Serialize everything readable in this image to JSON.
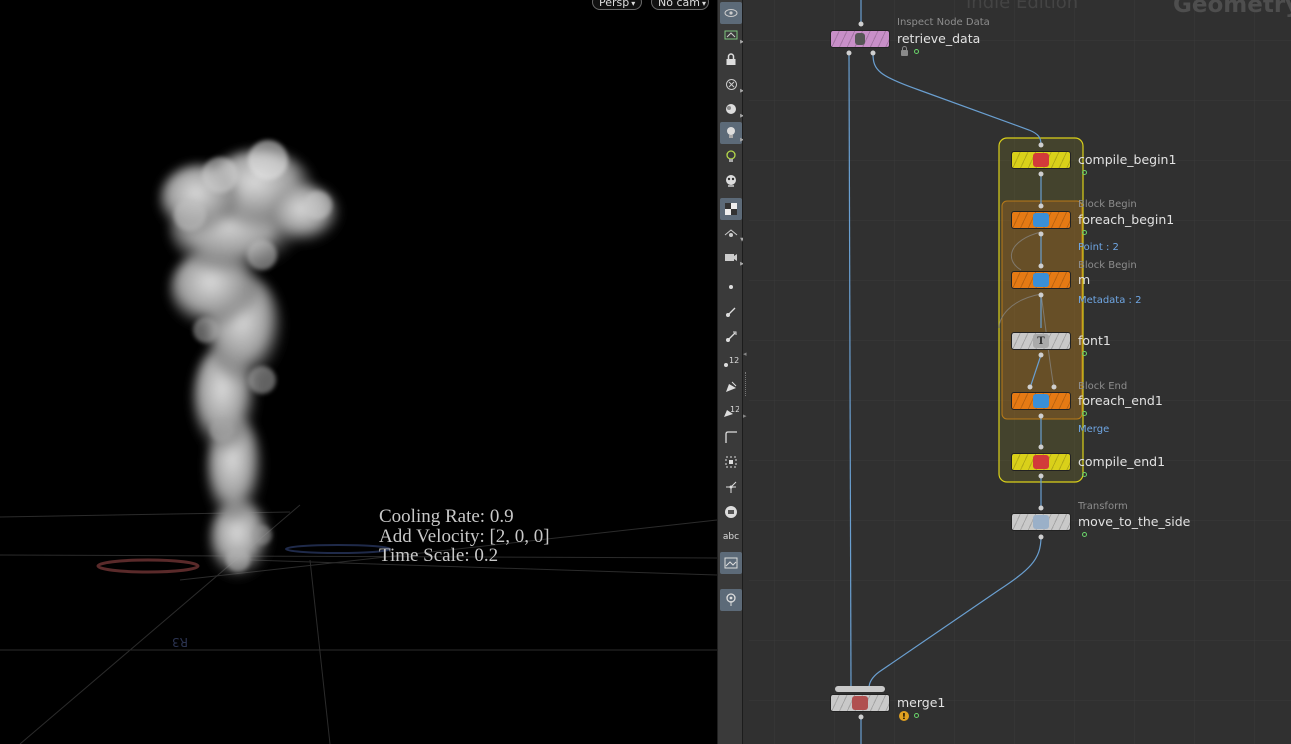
{
  "viewport": {
    "camera_view_menu": "Persp",
    "camera_menu": "No cam",
    "overlay_lines": [
      "Cooling Rate: 0.9",
      "Add Velocity: [2, 0, 0]",
      "Time Scale: 0.2"
    ]
  },
  "toolbar": {
    "icons": [
      "view-icon",
      "display-options-icon",
      "lock-view-icon",
      "ghost-icon",
      "display-background-icon",
      "light-icon",
      "headlight-icon",
      "persp-camera-icon",
      "checker-icon",
      "visualizer-icon",
      "snapshot-icon",
      "point-display-icon",
      "normal-display-icon",
      "vector-display-icon",
      "point-numbers-icon",
      "primitive-display-icon",
      "primitive-numbers-icon",
      "edge-display-icon",
      "points-display-icon",
      "pivot-icon",
      "face-display-icon",
      "text-display-icon",
      "background-image-icon",
      "pin-icon"
    ],
    "text_label": "abc",
    "numbers_label": "12"
  },
  "network": {
    "edition_watermark": "Indie Edition",
    "context_watermark": "Geometry",
    "nodes": [
      {
        "id": "retrieve_data",
        "name": "retrieve_data",
        "type": "Inspect Node Data",
        "info": "",
        "color": "#c88fc8"
      },
      {
        "id": "compile_begin1",
        "name": "compile_begin1",
        "type": "",
        "info": "",
        "color": "#d9d01a"
      },
      {
        "id": "foreach_begin1",
        "name": "foreach_begin1",
        "type": "Block Begin",
        "info": "Point : 2",
        "color": "#e57a14"
      },
      {
        "id": "m",
        "name": "m",
        "type": "Block Begin",
        "info": "Metadata : 2",
        "color": "#e57a14"
      },
      {
        "id": "font1",
        "name": "font1",
        "type": "",
        "info": "",
        "color": "#c9c9c9"
      },
      {
        "id": "foreach_end1",
        "name": "foreach_end1",
        "type": "Block End",
        "info": "Merge",
        "color": "#e57a14"
      },
      {
        "id": "compile_end1",
        "name": "compile_end1",
        "type": "",
        "info": "",
        "color": "#d9d01a"
      },
      {
        "id": "move_to_the_side",
        "name": "move_to_the_side",
        "type": "Transform",
        "info": "",
        "color": "#c9c9c9"
      },
      {
        "id": "merge1",
        "name": "merge1",
        "type": "",
        "info": "",
        "color": "#c9c9c9"
      }
    ],
    "compile_block_color": "#d9d01a",
    "foreach_block_color": "#e57a14",
    "wire_color": "#6a9fd0"
  }
}
